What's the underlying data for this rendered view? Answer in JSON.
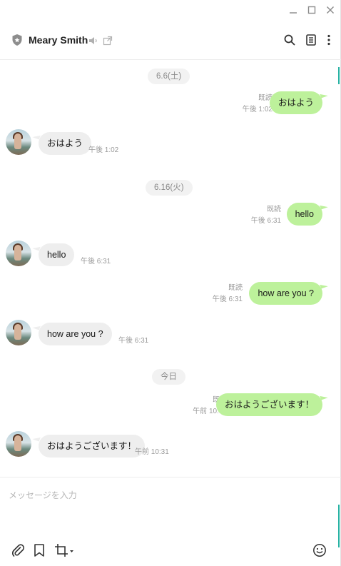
{
  "window": {
    "controls": [
      "minimize-icon",
      "maximize-icon",
      "close-icon"
    ]
  },
  "header": {
    "contact_name": "Meary Smith",
    "icons": [
      "shield-icon",
      "speaker-mute-icon",
      "external-link-icon",
      "search-icon",
      "notes-icon",
      "more-vertical-icon"
    ]
  },
  "messages": [
    {
      "type": "date",
      "text": "6.6(土)"
    },
    {
      "type": "me",
      "text": "おはよう",
      "read": "既読",
      "time": "午後 1:02"
    },
    {
      "type": "them",
      "text": "おはよう",
      "time": "午後 1:02"
    },
    {
      "type": "date",
      "text": "6.16(火)"
    },
    {
      "type": "me",
      "text": "hello",
      "read": "既読",
      "time": "午後 6:31"
    },
    {
      "type": "them",
      "text": "hello",
      "time": "午後 6:31"
    },
    {
      "type": "me",
      "text": "how are you ?",
      "read": "既読",
      "time": "午後 6:31"
    },
    {
      "type": "them",
      "text": "how are you ?",
      "time": "午後 6:31"
    },
    {
      "type": "date",
      "text": "今日"
    },
    {
      "type": "me",
      "text": "おはようございます！",
      "read": "既読",
      "time": "午前 10:31"
    },
    {
      "type": "them",
      "text": "おはようございます！",
      "time": "午前 10:31"
    }
  ],
  "composer": {
    "placeholder": "メッセージを入力",
    "tools": [
      "paperclip-icon",
      "bookmark-icon",
      "crop-icon",
      "emoji-icon"
    ]
  },
  "colors": {
    "my_bubble": "#bdf19b",
    "their_bubble": "#eeeeee",
    "accent": "#28b3a4"
  }
}
